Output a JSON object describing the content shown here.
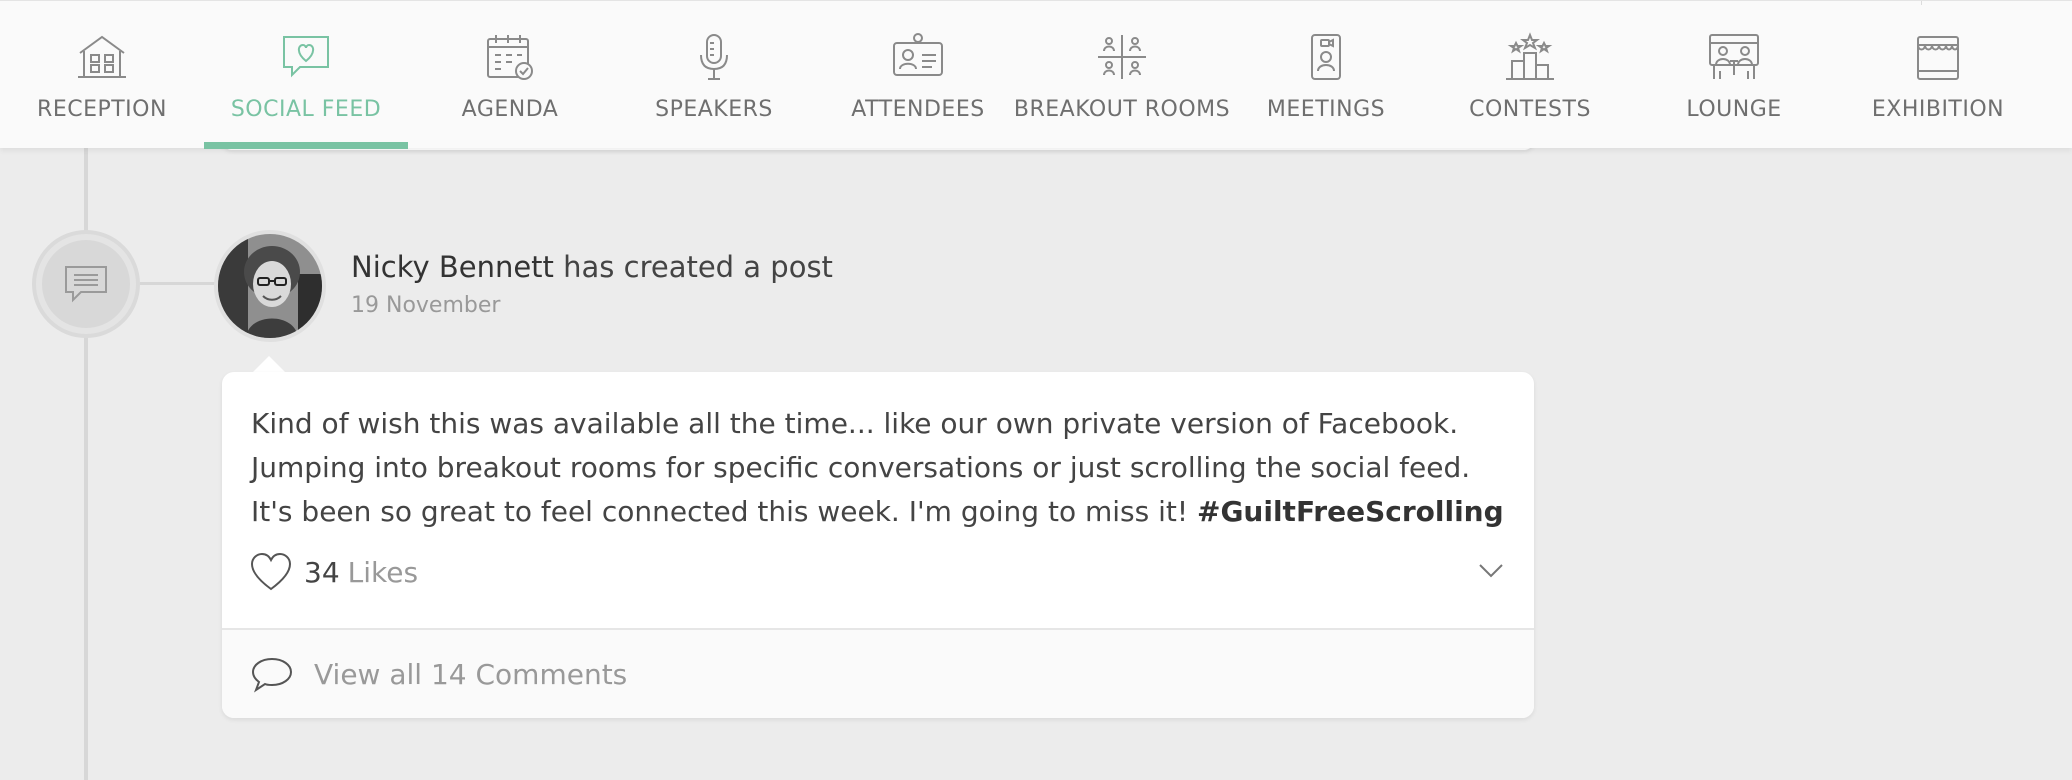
{
  "nav": {
    "items": [
      {
        "label": "RECEPTION",
        "icon": "building-icon"
      },
      {
        "label": "SOCIAL FEED",
        "icon": "heart-chat-icon",
        "active": true
      },
      {
        "label": "AGENDA",
        "icon": "calendar-check-icon"
      },
      {
        "label": "SPEAKERS",
        "icon": "microphone-icon"
      },
      {
        "label": "ATTENDEES",
        "icon": "id-card-icon"
      },
      {
        "label": "BREAKOUT ROOMS",
        "icon": "groups-icon"
      },
      {
        "label": "MEETINGS",
        "icon": "video-phone-icon"
      },
      {
        "label": "CONTESTS",
        "icon": "podium-icon"
      },
      {
        "label": "LOUNGE",
        "icon": "lounge-icon"
      },
      {
        "label": "EXHIBITION",
        "icon": "booth-icon"
      }
    ],
    "accent_color": "#79c3a3"
  },
  "post": {
    "author": "Nicky Bennett",
    "action": " has created a post",
    "date": "19 November",
    "text": "Kind of wish this was available all the time... like our own private version of Facebook. Jumping into breakout rooms for specific conversations or just scrolling the social feed. It's been so great to feel connected this week. I'm going to miss it! ",
    "hashtag": "#GuiltFreeScrolling",
    "likes_count": "34",
    "likes_label": "Likes",
    "comments_label": "View all 14 Comments"
  }
}
